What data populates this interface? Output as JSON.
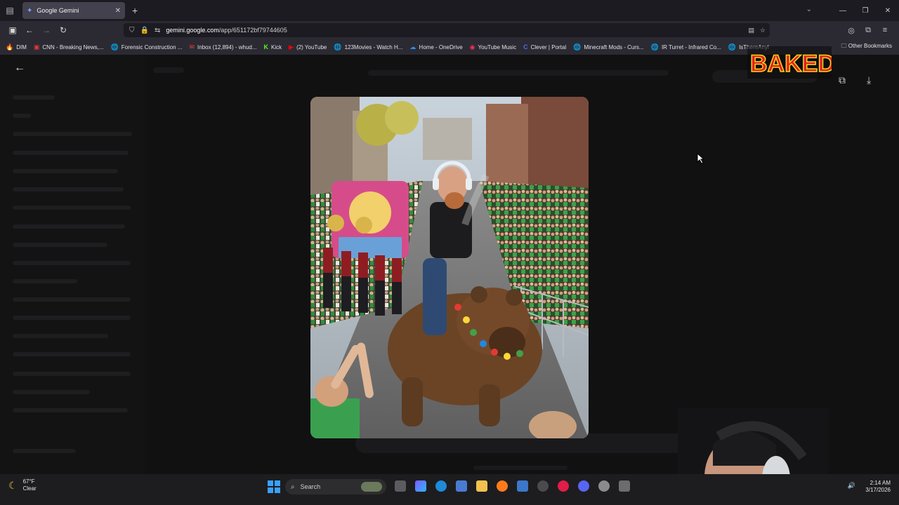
{
  "browser": {
    "tab": {
      "title": "Google Gemini",
      "close": "✕"
    },
    "new_tab": "+",
    "url": {
      "host": "gemini.google.com",
      "path": "/app/651172bf79744605"
    },
    "window_controls": {
      "minimize": "—",
      "maximize": "❐",
      "close": "✕"
    }
  },
  "bookmarks": [
    {
      "icon": "🔥",
      "label": "DIM"
    },
    {
      "icon": "▣",
      "label": "CNN - Breaking News,..."
    },
    {
      "icon": "🌐",
      "label": "Forensic Construction ..."
    },
    {
      "icon": "✉",
      "label": "Inbox (12,894) - whud..."
    },
    {
      "icon": "K",
      "label": "Kick"
    },
    {
      "icon": "▶",
      "label": "(2) YouTube"
    },
    {
      "icon": "🌐",
      "label": "123Movies - Watch H..."
    },
    {
      "icon": "☁",
      "label": "Home - OneDrive"
    },
    {
      "icon": "◉",
      "label": "YouTube Music"
    },
    {
      "icon": "C",
      "label": "Clever | Portal"
    },
    {
      "icon": "🌐",
      "label": "Minecraft Mods - Curs..."
    },
    {
      "icon": "🌐",
      "label": "IR Turret - Infrared Co..."
    },
    {
      "icon": "🌐",
      "label": "IsThereAnyl"
    }
  ],
  "bookmarks_other": "Other Bookmarks",
  "overlay_logo": "BAKED",
  "taskbar": {
    "weather_temp": "67°F",
    "weather_desc": "Clear",
    "search_label": "Search",
    "time": "2:14 AM",
    "date": "3/17/2026"
  },
  "colors": {
    "accent_blue": "#3aa0ff",
    "tab_active": "#42414d",
    "page_bg": "#0f0f10"
  }
}
